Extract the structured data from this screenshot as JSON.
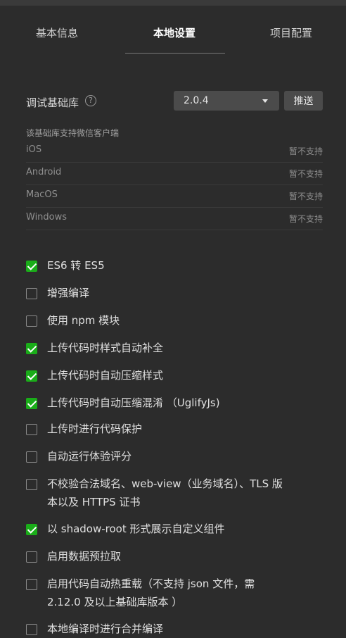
{
  "tabs": [
    {
      "label": "基本信息",
      "active": false
    },
    {
      "label": "本地设置",
      "active": true
    },
    {
      "label": "项目配置",
      "active": false
    }
  ],
  "debug_lib": {
    "label": "调试基础库",
    "help_glyph": "?",
    "version": "2.0.4",
    "push_label": "推送"
  },
  "support": {
    "caption": "该基础库支持微信客户端",
    "rows": [
      {
        "platform": "iOS",
        "status": "暂不支持"
      },
      {
        "platform": "Android",
        "status": "暂不支持"
      },
      {
        "platform": "MacOS",
        "status": "暂不支持"
      },
      {
        "platform": "Windows",
        "status": "暂不支持"
      }
    ]
  },
  "options": [
    {
      "label": "ES6 转 ES5",
      "checked": true
    },
    {
      "label": "增强编译",
      "checked": false
    },
    {
      "label": "使用 npm 模块",
      "checked": false
    },
    {
      "label": "上传代码时样式自动补全",
      "checked": true
    },
    {
      "label": "上传代码时自动压缩样式",
      "checked": true
    },
    {
      "label": "上传代码时自动压缩混淆 （UglifyJs)",
      "checked": true
    },
    {
      "label": "上传时进行代码保护",
      "checked": false
    },
    {
      "label": "自动运行体验评分",
      "checked": false
    },
    {
      "label": "不校验合法域名、web-view（业务域名）、TLS 版本以及 HTTPS 证书",
      "checked": false
    },
    {
      "label": "以 shadow-root 形式展示自定义组件",
      "checked": true
    },
    {
      "label": "启用数据预拉取",
      "checked": false
    },
    {
      "label": "启用代码自动热重载（不支持 json 文件，需 2.12.0 及以上基础库版本 ）",
      "checked": false
    },
    {
      "label": "本地编译时进行合并编译",
      "checked": false
    }
  ],
  "colors": {
    "background": "#2c2c2c",
    "checkbox_checked": "#1aad19",
    "control_bg": "#4b4b4b"
  }
}
